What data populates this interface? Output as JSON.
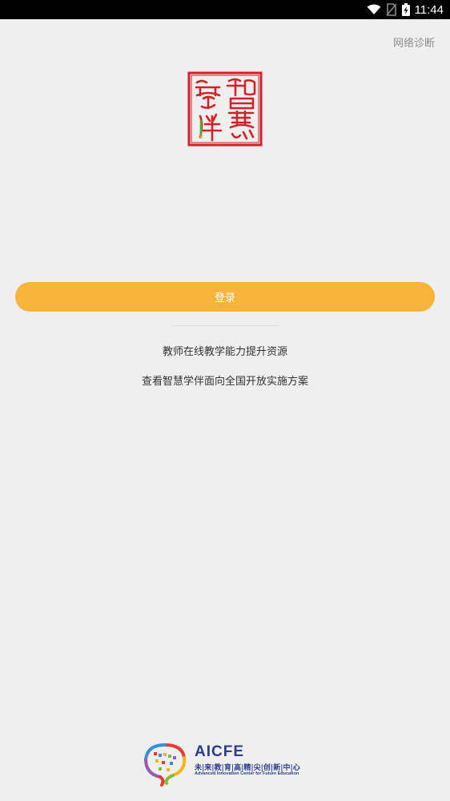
{
  "status_bar": {
    "time": "11:44",
    "icons": [
      "wifi-icon",
      "no-sim-icon",
      "battery-charging-icon"
    ]
  },
  "header": {
    "network_diagnosis": "网络诊断"
  },
  "logo": {
    "icon": "zhihui-xueban-seal-logo",
    "text": "智慧學伴",
    "color": "#d2232a"
  },
  "login": {
    "button_label": "登录",
    "button_color": "#f8b33a"
  },
  "links": {
    "teacher_resources": "教师在线教学能力提升资源",
    "open_plan": "查看智慧学伴面向全国开放实施方案"
  },
  "footer": {
    "brand": "AICFE",
    "cn_name": "未|来|教|育|高|精|尖|创|新|中|心",
    "en_name": "Advanced Innovation Center for Future Education",
    "brand_color": "#2c3c8c"
  }
}
